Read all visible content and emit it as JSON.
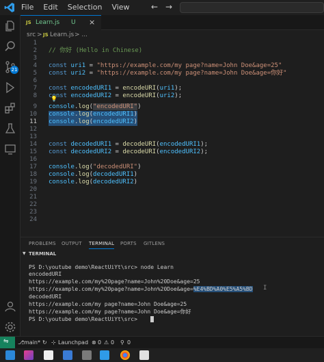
{
  "menu": [
    "File",
    "Edit",
    "Selection",
    "View"
  ],
  "tab": {
    "filename": "Learn.js",
    "lang": "JS",
    "status": "U",
    "close": "×"
  },
  "breadcrumb": {
    "folder": "src",
    "sep": ">",
    "lang": "JS",
    "file": "Learn.js",
    "more": "> ..."
  },
  "editor": {
    "lines": [
      {
        "n": "1",
        "text": ""
      },
      {
        "n": "2",
        "text": "// 你好 (Hello in Chinese)"
      },
      {
        "n": "3",
        "text": ""
      },
      {
        "n": "4",
        "text": "const uri1 = \"https://example.com/my page?name=John Doe&age=25\""
      },
      {
        "n": "5",
        "text": "const uri2 = \"https://example.com/my page?name=John Doe&age=你好\""
      },
      {
        "n": "6",
        "text": ""
      },
      {
        "n": "7",
        "text": "const encodedURI1 = encodeURI(uri1);"
      },
      {
        "n": "8",
        "text": "const encodedURI2 = encodeURI(uri2);"
      },
      {
        "n": "9",
        "text": "console.log(\"encodedURI\")"
      },
      {
        "n": "10",
        "text": "console.log(encodedURI1)"
      },
      {
        "n": "11",
        "text": "console.log(encodedURI2)"
      },
      {
        "n": "12",
        "text": ""
      },
      {
        "n": "13",
        "text": ""
      },
      {
        "n": "14",
        "text": "const decodedURI1 = decodeURI(encodedURI1);"
      },
      {
        "n": "15",
        "text": "const decodedURI2 = decodeURI(encodedURI2);"
      },
      {
        "n": "16",
        "text": ""
      },
      {
        "n": "17",
        "text": "console.log(\"decodedURI\")"
      },
      {
        "n": "18",
        "text": "console.log(decodedURI1)"
      },
      {
        "n": "19",
        "text": "console.log(decodedURI2)"
      },
      {
        "n": "20",
        "text": ""
      },
      {
        "n": "21",
        "text": ""
      },
      {
        "n": "22",
        "text": ""
      },
      {
        "n": "23",
        "text": ""
      },
      {
        "n": "24",
        "text": ""
      }
    ]
  },
  "panel": {
    "tabs": [
      "PROBLEMS",
      "OUTPUT",
      "TERMINAL",
      "PORTS",
      "GITLENS"
    ],
    "active_tab": "TERMINAL",
    "terminal_label": "TERMINAL"
  },
  "terminal": {
    "lines": [
      "PS D:\\youtube demo\\ReactUiYt\\src> node Learn",
      "encodedURI",
      "https://example.com/my%20page?name=John%20Doe&age=25",
      "https://example.com/my%20page?name=John%20Doe&age=%E4%BD%A0%E5%A5%BD",
      "decodedURI",
      "https://example.com/my page?name=John Doe&age=25",
      "https://example.com/my page?name=John Doe&age=你好",
      "PS D:\\youtube demo\\ReactUiYt\\src> "
    ],
    "selected_part": "%E4%BD%A0%E5%A5%BD"
  },
  "statusbar": {
    "branch": "main*",
    "launchpad": "Launchpad",
    "errors": "0",
    "warnings": "0",
    "ports": "0"
  },
  "activity_badge": "21",
  "colors": {
    "accent": "#0078d4",
    "remote": "#16825d",
    "selection": "#264f78"
  }
}
